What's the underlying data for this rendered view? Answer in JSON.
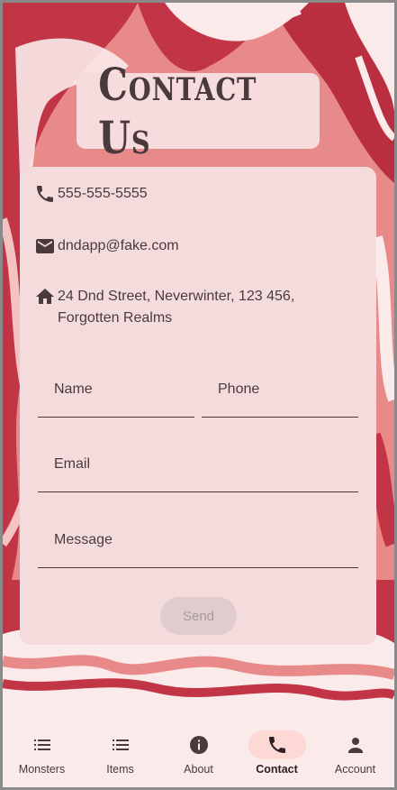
{
  "header": {
    "title": "Contact Us"
  },
  "contact": {
    "phone": "555-555-5555",
    "email": "dndapp@fake.com",
    "address_line1": "24 Dnd Street, Neverwinter, 123 456,",
    "address_line2": "Forgotten Realms"
  },
  "form": {
    "name_label": "Name",
    "phone_label": "Phone",
    "email_label": "Email",
    "message_label": "Message",
    "send_label": "Send"
  },
  "nav": {
    "items": [
      {
        "label": "Monsters",
        "icon": "list-icon"
      },
      {
        "label": "Items",
        "icon": "list-icon"
      },
      {
        "label": "About",
        "icon": "info-icon"
      },
      {
        "label": "Contact",
        "icon": "phone-icon",
        "active": true
      },
      {
        "label": "Account",
        "icon": "person-icon"
      }
    ]
  },
  "colors": {
    "accent_red": "#c23a48",
    "salmon": "#e88888",
    "card": "#f5dcdc",
    "text": "#4a3a3c"
  }
}
